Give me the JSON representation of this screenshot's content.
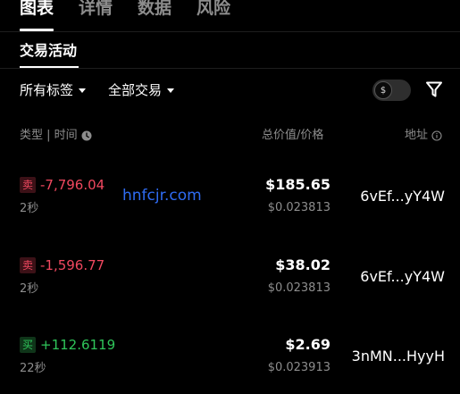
{
  "top_tabs": [
    {
      "label": "图表",
      "active": true
    },
    {
      "label": "详情",
      "active": false
    },
    {
      "label": "数据",
      "active": false
    },
    {
      "label": "风险",
      "active": false
    }
  ],
  "subtab": {
    "label": "交易活动"
  },
  "filters": {
    "tags": "所有标签",
    "trades": "全部交易"
  },
  "toggle": {
    "icon": "dollar-icon",
    "symbol": "$",
    "on": false
  },
  "headers": {
    "type_time": "类型 | 时间",
    "value_price": "总价值/价格",
    "address": "地址"
  },
  "trades": [
    {
      "side_label": "卖",
      "side": "sell",
      "amount": "-7,796.04",
      "age": "2秒",
      "total": "$185.65",
      "price": "$0.023813",
      "address": "6vEf...yY4W"
    },
    {
      "side_label": "卖",
      "side": "sell",
      "amount": "-1,596.77",
      "age": "2秒",
      "total": "$38.02",
      "price": "$0.023813",
      "address": "6vEf...yY4W"
    },
    {
      "side_label": "买",
      "side": "buy",
      "amount": "+112.6119",
      "age": "22秒",
      "total": "$2.69",
      "price": "$0.023913",
      "address": "3nMN...HyyH"
    }
  ],
  "watermark": "hnfcjr.com",
  "colors": {
    "sell": "#f0485f",
    "buy": "#2fc55a",
    "watermark": "#2f6cf3",
    "muted": "#8d8d8d"
  }
}
